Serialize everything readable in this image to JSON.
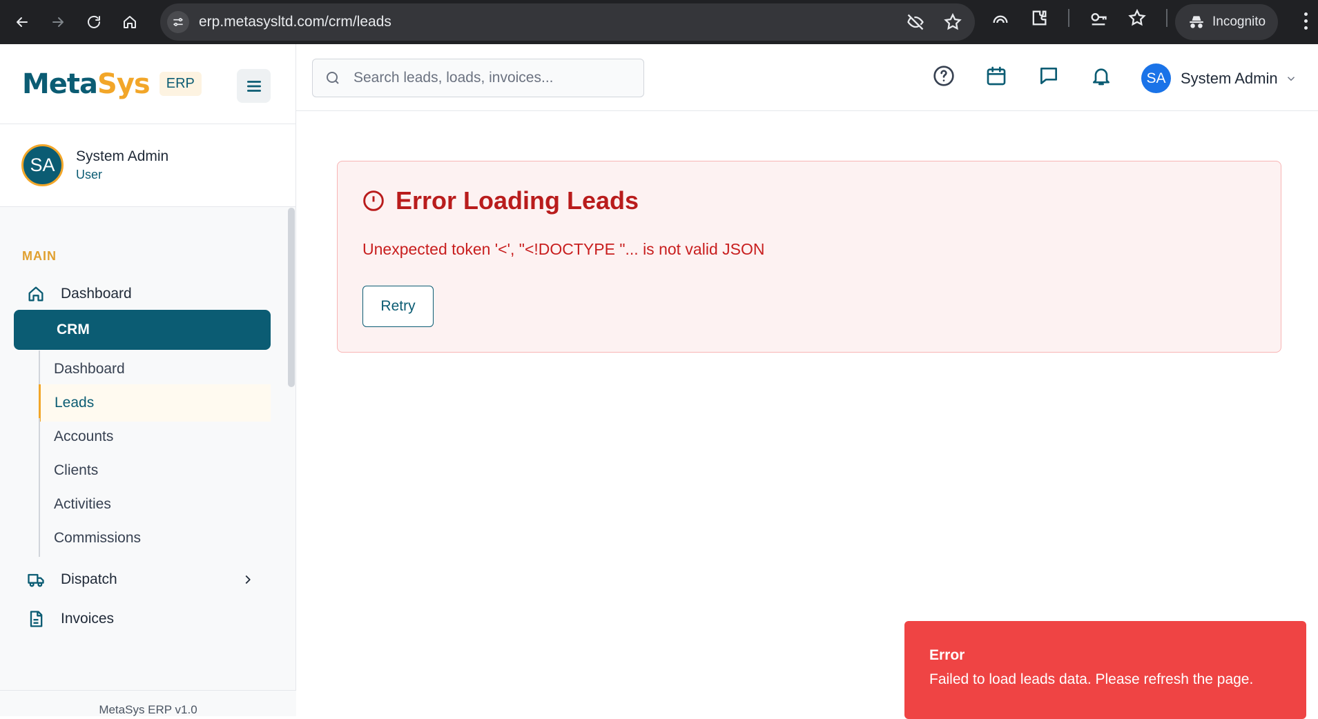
{
  "browser": {
    "url": "erp.metasysltd.com/crm/leads",
    "incognito_label": "Incognito"
  },
  "brand": {
    "logo_part1": "Meta",
    "logo_part2": "Sys",
    "badge": "ERP"
  },
  "user": {
    "initials": "SA",
    "name": "System Admin",
    "role": "User"
  },
  "sidebar": {
    "section_main": "MAIN",
    "items": [
      {
        "label": "Dashboard",
        "icon": "home-icon"
      },
      {
        "label": "CRM",
        "active": true
      },
      {
        "label": "Dispatch",
        "icon": "truck-icon"
      },
      {
        "label": "Invoices",
        "icon": "document-icon"
      }
    ],
    "crm_subitems": [
      "Dashboard",
      "Leads",
      "Accounts",
      "Clients",
      "Activities",
      "Commissions"
    ],
    "footer": "MetaSys ERP v1.0"
  },
  "topbar": {
    "search_placeholder": "Search leads, loads, invoices...",
    "profile_initials": "SA",
    "profile_name": "System Admin"
  },
  "error": {
    "title": "Error Loading Leads",
    "message": "Unexpected token '<', \"<!DOCTYPE \"... is not valid JSON",
    "retry_label": "Retry"
  },
  "toast": {
    "title": "Error",
    "body": "Failed to load leads data. Please refresh the page.",
    "color": "#ef4444"
  },
  "colors": {
    "brand_primary": "#0b5c73",
    "brand_accent": "#f2a629",
    "error_text": "#b91c1c"
  }
}
